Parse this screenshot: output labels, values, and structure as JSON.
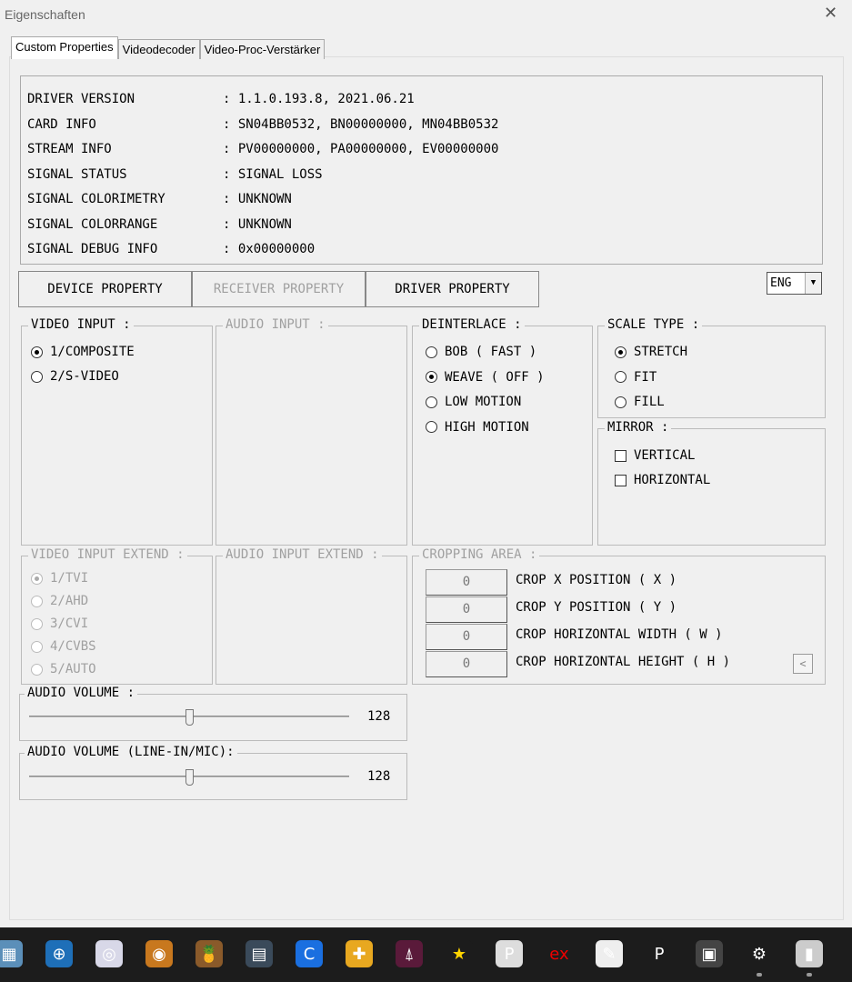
{
  "window": {
    "title": "Eigenschaften",
    "close": "✕"
  },
  "tabs": [
    "Custom Properties",
    "Videodecoder",
    "Video-Proc-Verstärker"
  ],
  "info": [
    {
      "key": "DRIVER VERSION",
      "value": ": 1.1.0.193.8, 2021.06.21"
    },
    {
      "key": "CARD INFO",
      "value": ": SN04BB0532, BN00000000, MN04BB0532"
    },
    {
      "key": "STREAM INFO",
      "value": ": PV00000000, PA00000000, EV00000000"
    },
    {
      "key": "SIGNAL STATUS",
      "value": ": SIGNAL LOSS"
    },
    {
      "key": "SIGNAL COLORIMETRY",
      "value": ": UNKNOWN"
    },
    {
      "key": "SIGNAL COLORRANGE",
      "value": ": UNKNOWN"
    },
    {
      "key": "SIGNAL DEBUG INFO",
      "value": ": 0x00000000"
    }
  ],
  "property_buttons": [
    "DEVICE PROPERTY",
    "RECEIVER PROPERTY",
    "DRIVER PROPERTY"
  ],
  "language": "ENG",
  "video_input": {
    "label": "VIDEO INPUT :",
    "options": [
      "1/COMPOSITE",
      "2/S-VIDEO"
    ],
    "selected": 0
  },
  "audio_input": {
    "label": "AUDIO INPUT :"
  },
  "deinterlace": {
    "label": "DEINTERLACE :",
    "options": [
      "BOB ( FAST )",
      "WEAVE ( OFF )",
      "LOW MOTION",
      "HIGH MOTION"
    ],
    "selected": 1
  },
  "scale_type": {
    "label": "SCALE TYPE :",
    "options": [
      "STRETCH",
      "FIT",
      "FILL"
    ],
    "selected": 0
  },
  "mirror": {
    "label": "MIRROR :",
    "options": [
      "VERTICAL",
      "HORIZONTAL"
    ]
  },
  "video_input_extend": {
    "label": "VIDEO INPUT EXTEND :",
    "options": [
      "1/TVI",
      "2/AHD",
      "3/CVI",
      "4/CVBS",
      "5/AUTO"
    ],
    "selected": 0
  },
  "audio_input_extend": {
    "label": "AUDIO INPUT EXTEND :"
  },
  "cropping": {
    "label": "CROPPING AREA :",
    "rows": [
      {
        "value": "0",
        "label": "CROP X POSITION ( X )"
      },
      {
        "value": "0",
        "label": "CROP Y POSITION ( Y )"
      },
      {
        "value": "0",
        "label": "CROP HORIZONTAL WIDTH ( W )"
      },
      {
        "value": "0",
        "label": "CROP HORIZONTAL HEIGHT ( H )"
      }
    ],
    "button": "<"
  },
  "audio_volume": {
    "label": "AUDIO VOLUME :",
    "value": "128",
    "fraction": 0.5
  },
  "audio_volume_line": {
    "label": "AUDIO VOLUME (LINE-IN/MIC):",
    "value": "128",
    "fraction": 0.5
  },
  "taskbar": [
    {
      "icon": "calculator-icon",
      "color": "#5b8fb9",
      "glyph": "▦"
    },
    {
      "icon": "zoom-search-icon",
      "color": "#1e6fb8",
      "glyph": "⊕"
    },
    {
      "icon": "dvd-icon",
      "color": "#d8d8e8",
      "glyph": "◎"
    },
    {
      "icon": "burn-disc-icon",
      "color": "#c8781e",
      "glyph": "◉"
    },
    {
      "icon": "handbrake-icon",
      "color": "#8a5a2a",
      "glyph": "🍍"
    },
    {
      "icon": "video-film-icon",
      "color": "#3a4a5a",
      "glyph": "▤"
    },
    {
      "icon": "c-app-icon",
      "color": "#1a6fe0",
      "glyph": "C"
    },
    {
      "icon": "ppsspp-icon",
      "color": "#e8a820",
      "glyph": "✚"
    },
    {
      "icon": "cleaner-icon",
      "color": "#5a1a3a",
      "glyph": "⍋"
    },
    {
      "icon": "star-icon",
      "color": "#1c1c1c",
      "glyph": "★"
    },
    {
      "icon": "pdf24-icon",
      "color": "#ddd",
      "glyph": "P"
    },
    {
      "icon": "ex-icon",
      "color": "#1c1c1c",
      "glyph": "ex"
    },
    {
      "icon": "document-edit-icon",
      "color": "#eee",
      "glyph": "✎"
    },
    {
      "icon": "photo-editor-icon",
      "color": "#1c1c1c",
      "glyph": "P"
    },
    {
      "icon": "dvd-tool-icon",
      "color": "#444",
      "glyph": "▣"
    },
    {
      "icon": "settings-icon",
      "color": "#1c1c1c",
      "glyph": "⚙"
    },
    {
      "icon": "device-icon",
      "color": "#ccc",
      "glyph": "▮"
    }
  ]
}
